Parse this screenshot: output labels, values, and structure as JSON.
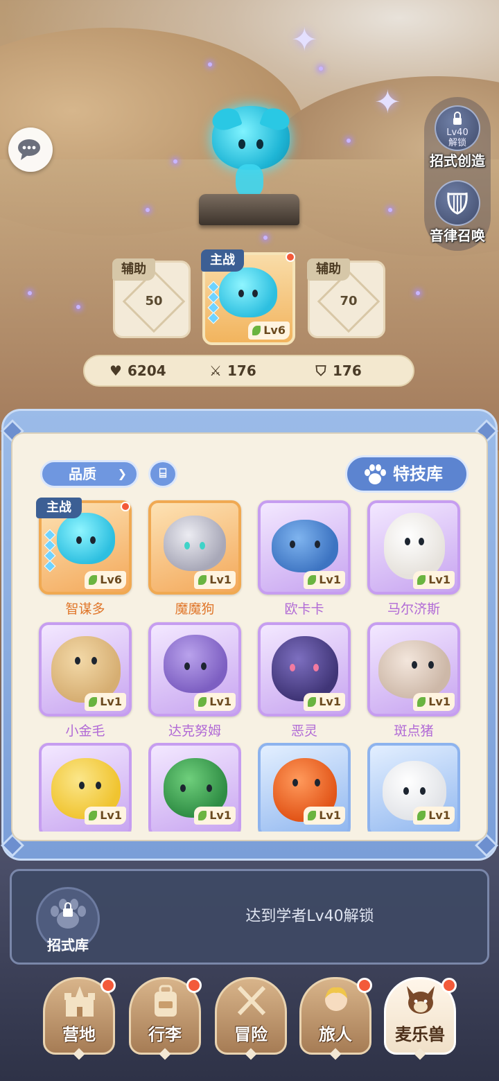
{
  "side_buttons": {
    "move_create": {
      "label": "招式创造",
      "lock_text_1": "Lv40",
      "lock_text_2": "解锁"
    },
    "melody_summon": {
      "label": "音律召唤"
    }
  },
  "team": {
    "left_slot": {
      "tag": "辅助",
      "unlock_level": "50"
    },
    "main_slot": {
      "tag": "主战",
      "level": "Lv6"
    },
    "right_slot": {
      "tag": "辅助",
      "unlock_level": "70"
    }
  },
  "stats": {
    "hp": "6204",
    "attack": "176",
    "defense": "176"
  },
  "panel": {
    "quality_label": "品质",
    "book_icon_glyph": "⌸",
    "skill_library_label": "特技库"
  },
  "pets": [
    {
      "name": "智谋多",
      "level": "Lv6",
      "tag": "主战",
      "rarity": "orange",
      "color": "#35c6e6"
    },
    {
      "name": "魔魔狗",
      "level": "Lv1",
      "rarity": "orange",
      "color": "#c9c9d2"
    },
    {
      "name": "欧卡卡",
      "level": "Lv1",
      "rarity": "purple",
      "color": "#4f8fd6"
    },
    {
      "name": "马尔济斯",
      "level": "Lv1",
      "rarity": "purple",
      "color": "#f7f5f0"
    },
    {
      "name": "小金毛",
      "level": "Lv1",
      "rarity": "purple",
      "color": "#e6c48a"
    },
    {
      "name": "达克努姆",
      "level": "Lv1",
      "rarity": "purple",
      "color": "#9b7fd3"
    },
    {
      "name": "恶灵",
      "level": "Lv1",
      "rarity": "purple",
      "color": "#5d4f9e"
    },
    {
      "name": "斑点猪",
      "level": "Lv1",
      "rarity": "purple",
      "color": "#e8d8cc"
    },
    {
      "name": "",
      "level": "Lv1",
      "rarity": "purple",
      "color": "#f5d23a"
    },
    {
      "name": "",
      "level": "Lv1",
      "rarity": "purple",
      "color": "#3fa55a"
    },
    {
      "name": "",
      "level": "Lv1",
      "rarity": "blue",
      "color": "#ee6b2c"
    },
    {
      "name": "",
      "level": "Lv1",
      "rarity": "blue",
      "color": "#f3f3f3"
    }
  ],
  "unlock_bar": {
    "text": "达到学者Lv40解锁",
    "button_label": "招式库"
  },
  "nav": [
    {
      "label": "营地",
      "icon": "castle-icon"
    },
    {
      "label": "行李",
      "icon": "backpack-icon"
    },
    {
      "label": "冒险",
      "icon": "crossed-swords-icon"
    },
    {
      "label": "旅人",
      "icon": "traveler-icon"
    },
    {
      "label": "麦乐兽",
      "icon": "fox-pet-icon",
      "active": true
    }
  ]
}
